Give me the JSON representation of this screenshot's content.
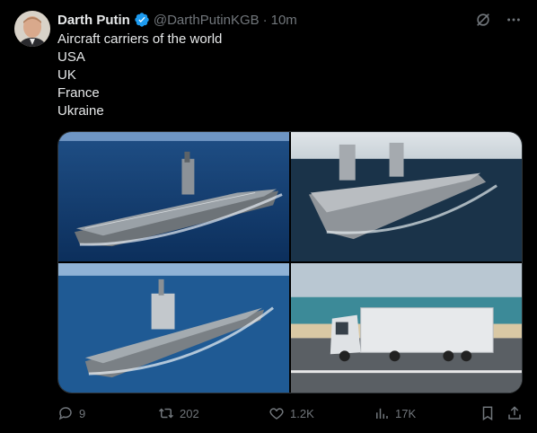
{
  "author": {
    "name": "Darth Putin",
    "handle": "@DarthPutinKGB",
    "separator": "·",
    "time": "10m",
    "verified_color": "#1d9bf0"
  },
  "tweet": {
    "lines": [
      "Aircraft carriers of the world",
      "USA",
      "UK",
      "France",
      "Ukraine"
    ]
  },
  "media": {
    "tiles": [
      "aircraft-carrier-usa",
      "aircraft-carrier-uk",
      "aircraft-carrier-france",
      "semi-truck-ukraine"
    ]
  },
  "actions": {
    "replies": "9",
    "reposts": "202",
    "likes": "1.2K",
    "views": "17K"
  },
  "icons": {
    "grok": "grok-icon",
    "more": "more-icon",
    "reply": "reply-icon",
    "repost": "repost-icon",
    "like": "heart-icon",
    "views": "views-icon",
    "bookmark": "bookmark-icon",
    "share": "share-icon"
  },
  "colors": {
    "background": "#000000",
    "text": "#e7e9ea",
    "muted": "#71767b",
    "accent": "#1d9bf0"
  }
}
